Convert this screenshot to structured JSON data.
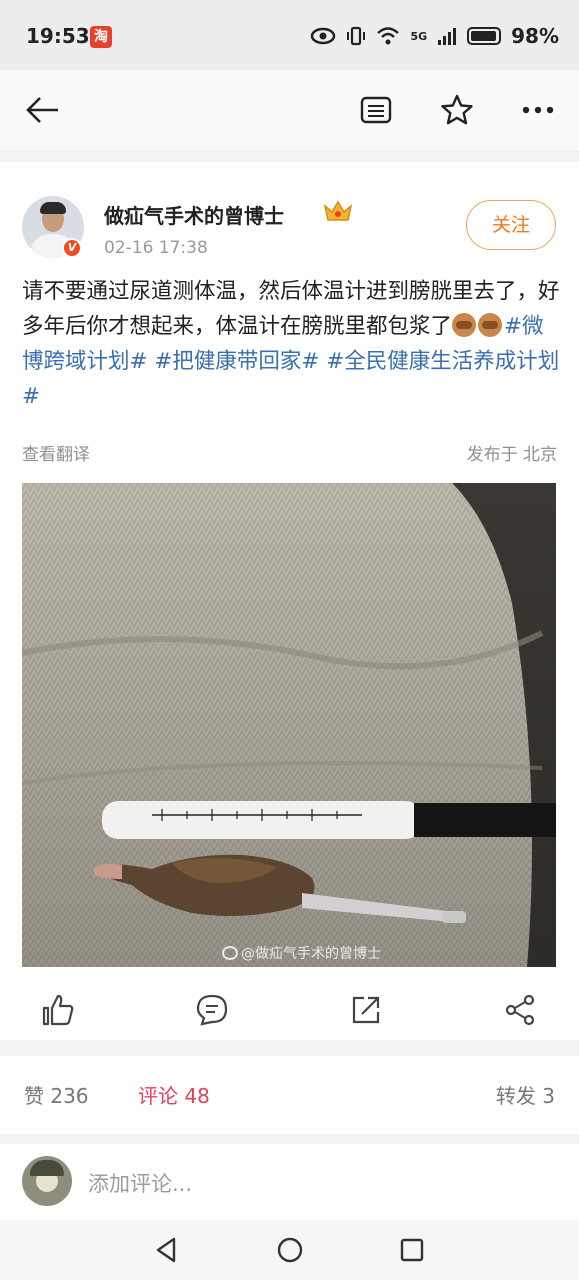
{
  "status_bar": {
    "time": "19:53",
    "app_icon_glyph": "淘",
    "network": "5G",
    "battery": "98%"
  },
  "nav": {
    "icons": [
      "back-arrow-icon",
      "reader-mode-icon",
      "star-icon",
      "more-icon"
    ]
  },
  "post": {
    "author": "做疝气手术的曾博士",
    "verified_badge": "V",
    "time": "02-16 17:38",
    "follow_label": "关注",
    "text_plain": "请不要通过尿道测体温，然后体温计进到膀胱里去了，好多年后你才想起来，体温计在膀胱里都包浆了",
    "topics": [
      "#微博跨域计划#",
      "#把健康带回家#",
      "#全民健康生活养成计划#"
    ],
    "translate_label": "查看翻译",
    "location_label": "发布于 北京",
    "image_watermark": "@做疝气手术的曾博士",
    "actions": [
      "like-icon",
      "comment-icon",
      "repost-icon",
      "share-icon"
    ]
  },
  "stats": {
    "likes": "赞 236",
    "comments": "评论 48",
    "reposts": "转发 3"
  },
  "composer": {
    "placeholder": "添加评论..."
  },
  "colors": {
    "topic": "#3a6fb0",
    "follow": "#f07a1a",
    "active_tab": "#e3415c"
  }
}
